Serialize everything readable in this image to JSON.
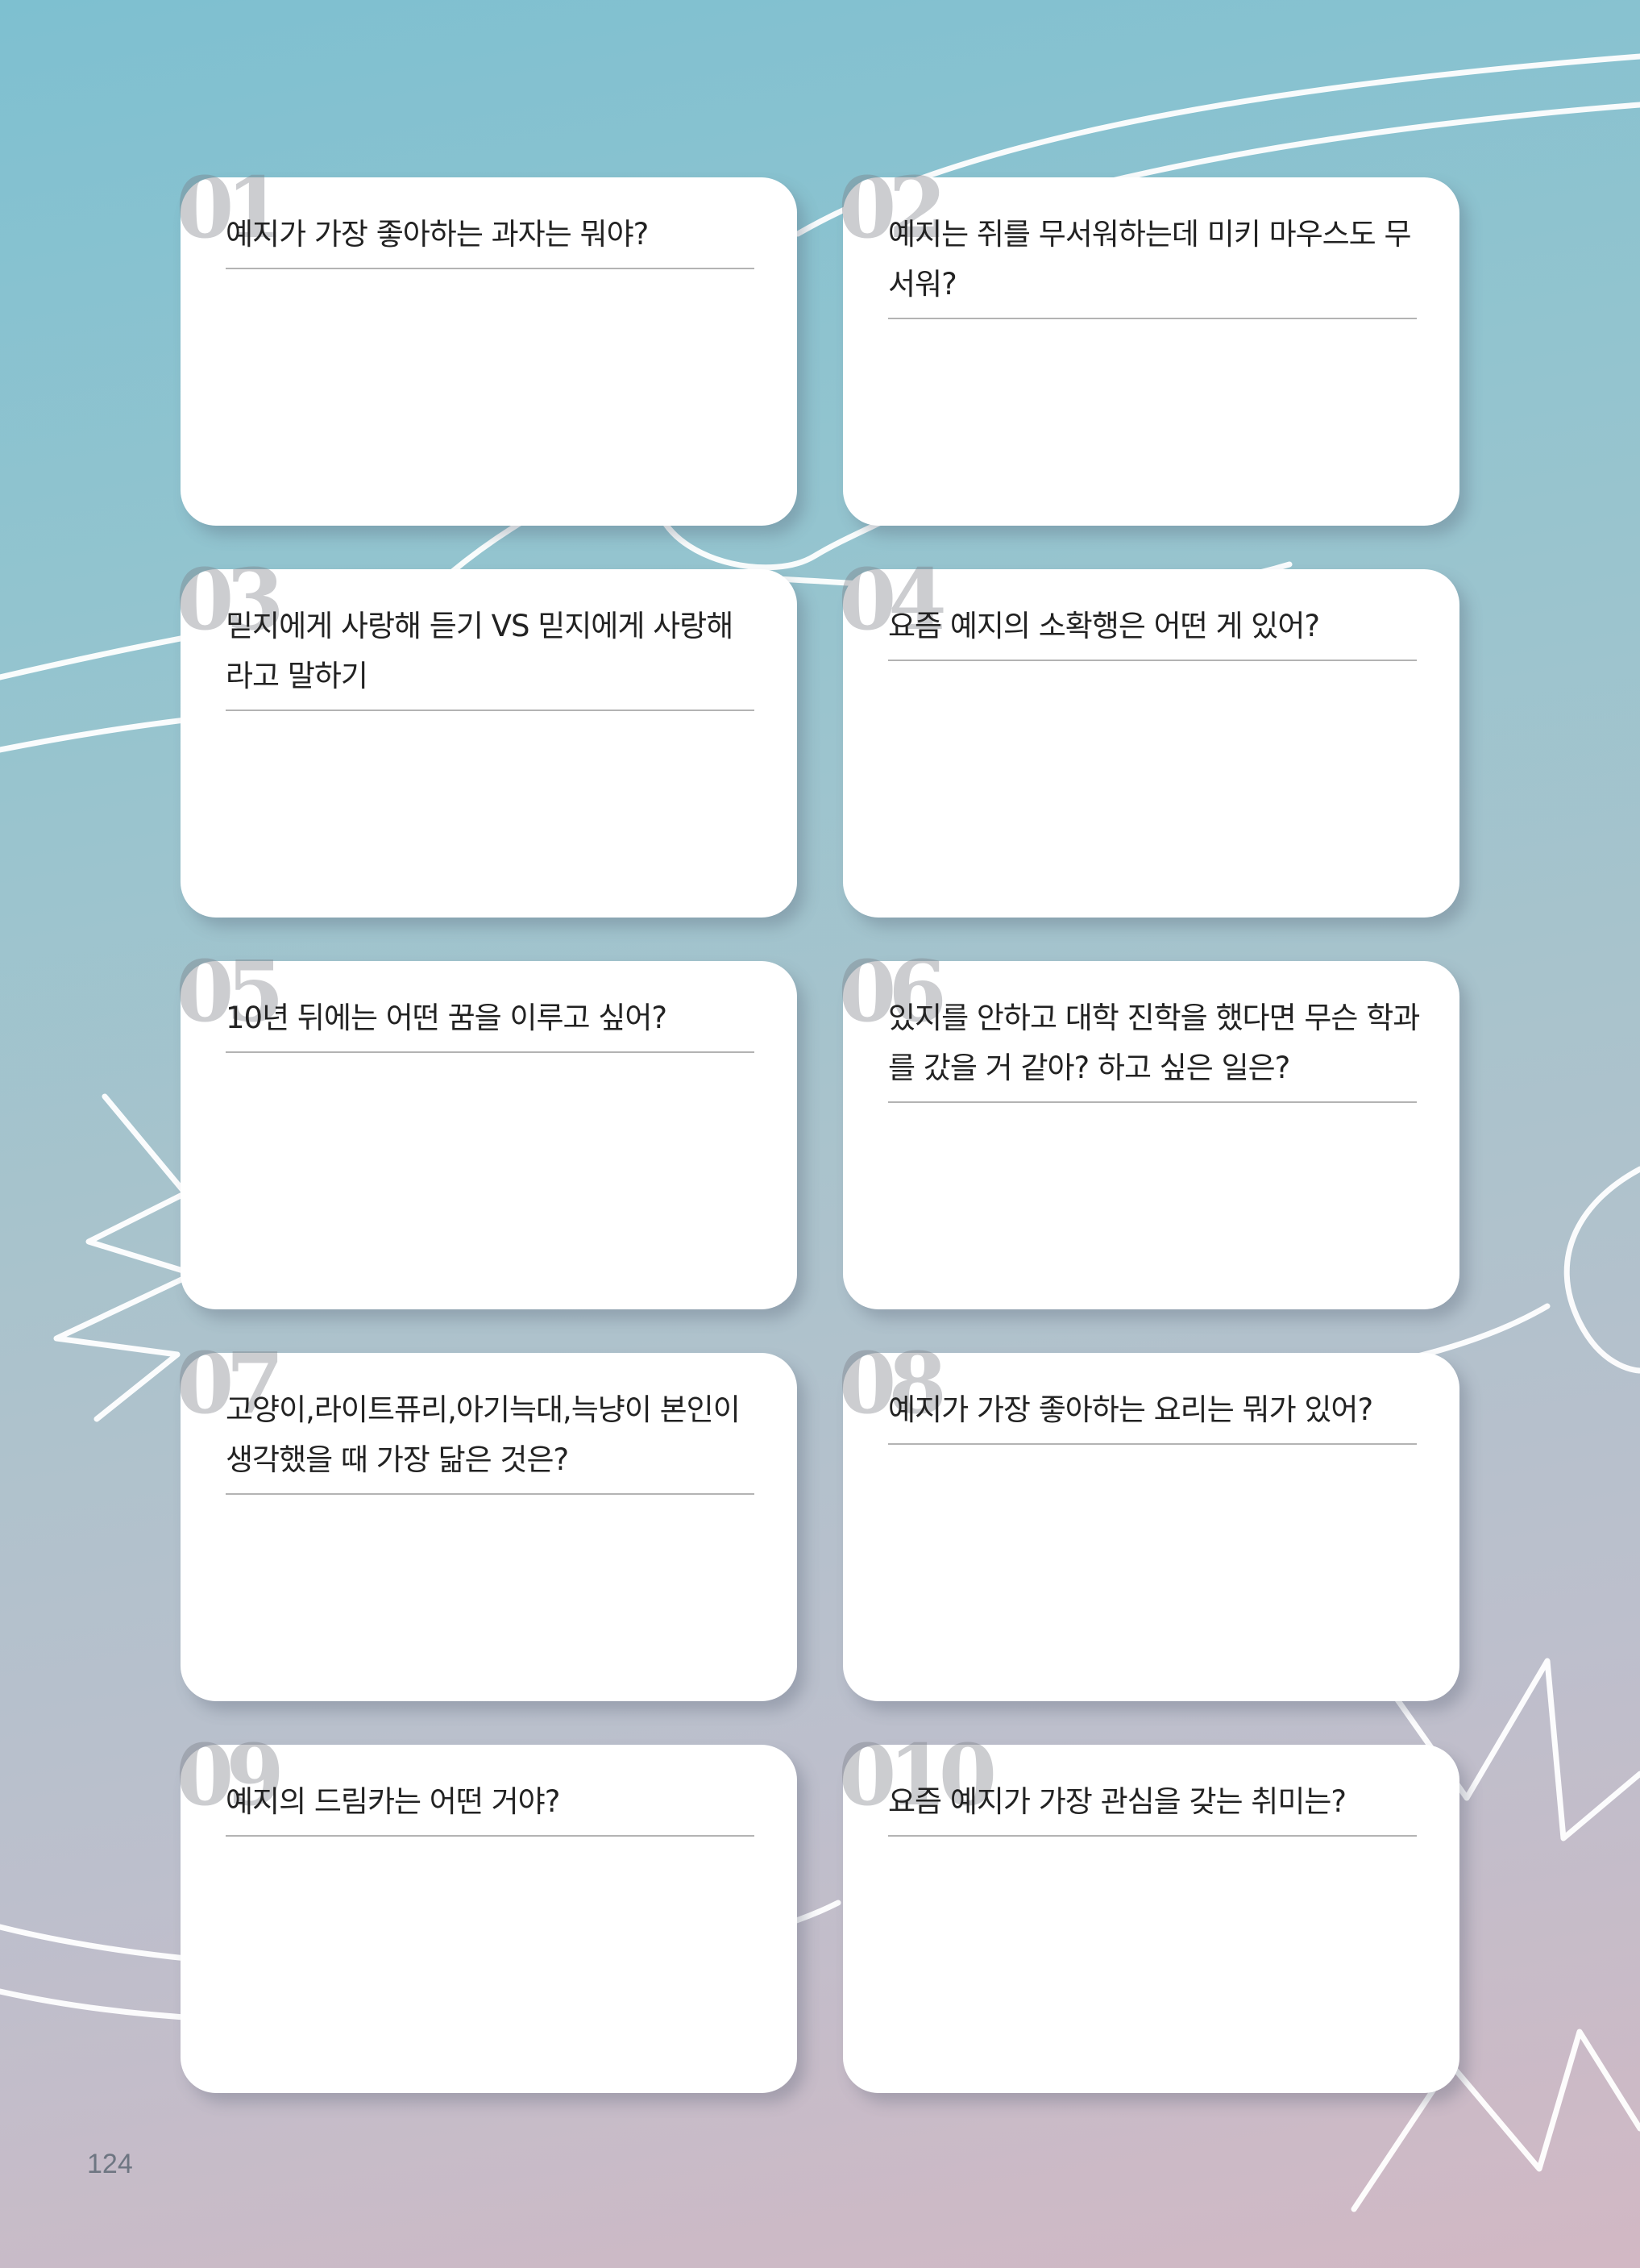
{
  "page": {
    "number": "124"
  },
  "questions": [
    {
      "num": "01",
      "text": "예지가 가장 좋아하는 과자는 뭐야?"
    },
    {
      "num": "02",
      "text": "예지는 쥐를 무서워하는데 미키 마우스도 무서워?"
    },
    {
      "num": "03",
      "text": "믿지에게 사랑해 듣기 VS 믿지에게 사랑해 라고 말하기"
    },
    {
      "num": "04",
      "text": "요즘 예지의 소확행은 어떤 게 있어?"
    },
    {
      "num": "05",
      "text": "10년 뒤에는 어떤 꿈을 이루고 싶어?"
    },
    {
      "num": "06",
      "text": "있지를 안하고 대학 진학을 했다면 무슨 학과를 갔을 거 같아? 하고 싶은 일은?"
    },
    {
      "num": "07",
      "text": "고양이,라이트퓨리,아기늑대,늑냥이 본인이 생각했을 때 가장 닮은 것은?"
    },
    {
      "num": "08",
      "text": "예지가 가장 좋아하는 요리는 뭐가 있어?"
    },
    {
      "num": "09",
      "text": "예지의 드림카는 어떤 거야?"
    },
    {
      "num": "010",
      "text": "요즘 예지가 가장 관심을 갖는 취미는?"
    }
  ]
}
